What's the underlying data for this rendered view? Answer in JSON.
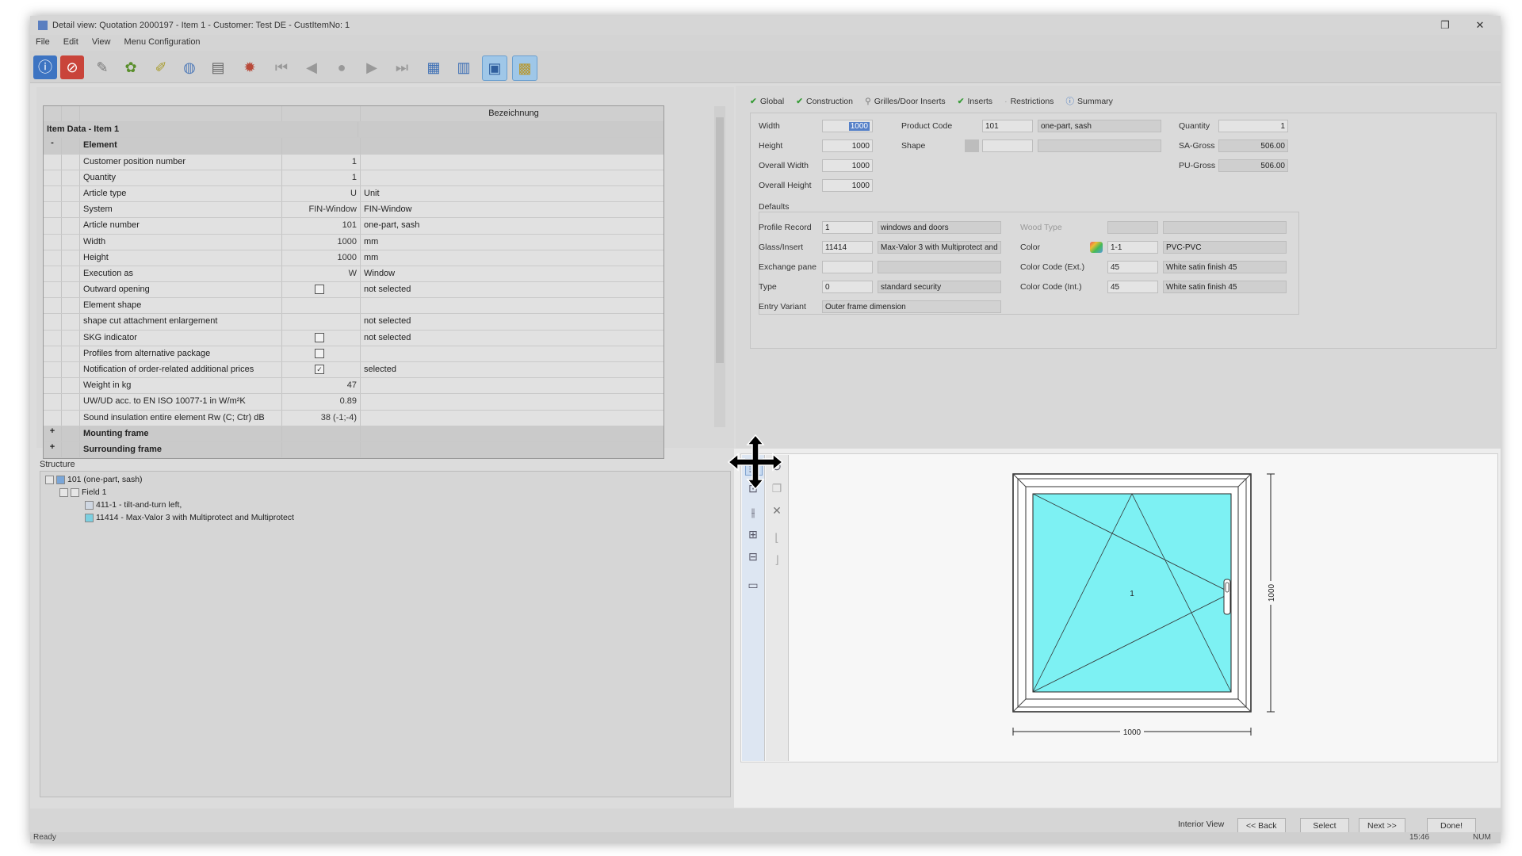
{
  "window": {
    "title": "Detail view: Quotation 2000197 - Item 1 - Customer: Test DE - CustItemNo: 1",
    "restore_glyph": "❐",
    "close_glyph": "✕"
  },
  "menu": [
    "File",
    "Edit",
    "View",
    "Menu Configuration"
  ],
  "toolbar": {
    "icons": [
      "info-icon",
      "stop-icon",
      "wrench-icon",
      "color-wheel-icon",
      "palette-icon",
      "globe-icon",
      "document-icon",
      "bulb-icon",
      "first-record-icon",
      "prev-record-icon",
      "record-dot-icon",
      "next-record-icon",
      "last-record-icon",
      "grid-view-icon",
      "list-view-icon",
      "window-drawing-icon",
      "structure-view-icon"
    ],
    "glyphs": [
      "ⓘ",
      "⊘",
      "✎",
      "✿",
      "✐",
      "◍",
      "▤",
      "✹",
      "⏮",
      "◀",
      "●",
      "▶",
      "⏭",
      "▦",
      "▥",
      "▣",
      "▩"
    ]
  },
  "grid": {
    "header": "Bezeichnung",
    "group_title": "Item Data - Item 1",
    "rows": [
      {
        "type": "section",
        "toggle": "-",
        "label": "Element",
        "value": "",
        "desc": ""
      },
      {
        "type": "row",
        "label": "Customer position number",
        "value": "1",
        "desc": ""
      },
      {
        "type": "row",
        "label": "Quantity",
        "value": "1",
        "desc": ""
      },
      {
        "type": "row",
        "label": "Article type",
        "value": "U",
        "desc": "Unit"
      },
      {
        "type": "row",
        "label": "System",
        "value": "FIN-Window",
        "desc": "FIN-Window"
      },
      {
        "type": "row",
        "label": "Article number",
        "value": "101",
        "desc": "one-part, sash"
      },
      {
        "type": "row",
        "label": "Width",
        "value": "1000",
        "desc": "mm"
      },
      {
        "type": "row",
        "label": "Height",
        "value": "1000",
        "desc": "mm"
      },
      {
        "type": "row",
        "label": "Execution as",
        "value": "W",
        "desc": "Window"
      },
      {
        "type": "check",
        "label": "Outward opening",
        "checked": false,
        "desc": "not selected"
      },
      {
        "type": "row",
        "label": "Element shape",
        "value": "",
        "desc": ""
      },
      {
        "type": "row",
        "label": "shape cut attachment enlargement",
        "value": "",
        "desc": "not selected"
      },
      {
        "type": "check",
        "label": "SKG indicator",
        "checked": false,
        "desc": "not selected"
      },
      {
        "type": "check",
        "label": "Profiles from alternative package",
        "checked": false,
        "desc": ""
      },
      {
        "type": "check",
        "label": "Notification of order-related additional prices",
        "checked": true,
        "desc": "selected"
      },
      {
        "type": "row",
        "label": "Weight in kg",
        "value": "47",
        "desc": ""
      },
      {
        "type": "row",
        "label": "UW/UD acc. to EN ISO 10077-1 in W/m²K",
        "value": "0.89",
        "desc": ""
      },
      {
        "type": "row",
        "label": "Sound insulation entire element Rw (C; Ctr) dB",
        "value": "38 (-1;-4)",
        "desc": ""
      },
      {
        "type": "section",
        "toggle": "+",
        "label": "Mounting frame",
        "value": "",
        "desc": ""
      },
      {
        "type": "section",
        "toggle": "+",
        "label": "Surrounding frame",
        "value": "",
        "desc": ""
      }
    ]
  },
  "structure": {
    "label": "Structure",
    "items": [
      {
        "text": "101 (one-part, sash)",
        "level": 0
      },
      {
        "text": "Field 1",
        "level": 1
      },
      {
        "text": "411-1 - tilt-and-turn left,",
        "level": 2
      },
      {
        "text": "11414 - Max-Valor 3 with Multiprotect and Multiprotect",
        "level": 2
      }
    ]
  },
  "tabs": [
    {
      "label": "Global",
      "status": "check"
    },
    {
      "label": "Construction",
      "status": "check"
    },
    {
      "label": "Grilles/Door Inserts",
      "status": "pin"
    },
    {
      "label": "Inserts",
      "status": "check"
    },
    {
      "label": "Restrictions",
      "status": "none"
    },
    {
      "label": "Summary",
      "status": "info"
    }
  ],
  "form": {
    "width_label": "Width",
    "width_value": "1000",
    "height_label": "Height",
    "height_value": "1000",
    "overall_width_label": "Overall Width",
    "overall_width_value": "1000",
    "overall_height_label": "Overall Height",
    "overall_height_value": "1000",
    "product_code_label": "Product Code",
    "product_code_value": "101",
    "product_code_desc": "one-part, sash",
    "shape_label": "Shape",
    "quantity_label": "Quantity",
    "quantity_value": "1",
    "sa_gross_label": "SA-Gross",
    "sa_gross_value": "506.00",
    "pu_gross_label": "PU-Gross",
    "pu_gross_value": "506.00",
    "defaults_label": "Defaults",
    "profile_record_label": "Profile Record",
    "profile_record_value": "1",
    "profile_record_desc": "windows and doors",
    "glass_label": "Glass/Insert",
    "glass_value": "11414",
    "glass_desc": "Max-Valor 3 with Multiprotect and",
    "exchange_label": "Exchange pane",
    "type_label": "Type",
    "type_value": "0",
    "type_desc": "standard security",
    "entry_variant_label": "Entry Variant",
    "entry_variant_value": "Outer frame dimension",
    "wood_type_label": "Wood Type",
    "color_label": "Color",
    "color_value": "1-1",
    "color_desc": "PVC-PVC",
    "color_ext_label": "Color Code (Ext.)",
    "color_ext_value": "45",
    "color_ext_desc": "White satin finish 45",
    "color_int_label": "Color Code (Int.)",
    "color_int_value": "45",
    "color_int_desc": "White satin finish 45"
  },
  "drawing": {
    "field_number": "1",
    "width_dim": "1000",
    "height_dim": "1000",
    "glass_color": "#7df1f3",
    "tool_icons": [
      "select-tool-icon",
      "zoom-tool-icon",
      "split-vertical-icon",
      "split-horizontal-icon",
      "split-grid-icon",
      "view-icon"
    ],
    "tool_icons2": [
      "no-entry-icon",
      "copy-icon",
      "delete-icon",
      "sash-left-icon",
      "sash-right-icon"
    ]
  },
  "bottom": {
    "interior_view": "Interior View",
    "back": "<< Back",
    "select": "Select",
    "next": "Next >>",
    "done": "Done!"
  },
  "status": {
    "left": "Ready",
    "time": "15:46",
    "mode": "NUM"
  },
  "colors": {
    "accent": "#3a9d3a",
    "selection": "#5580c8"
  }
}
